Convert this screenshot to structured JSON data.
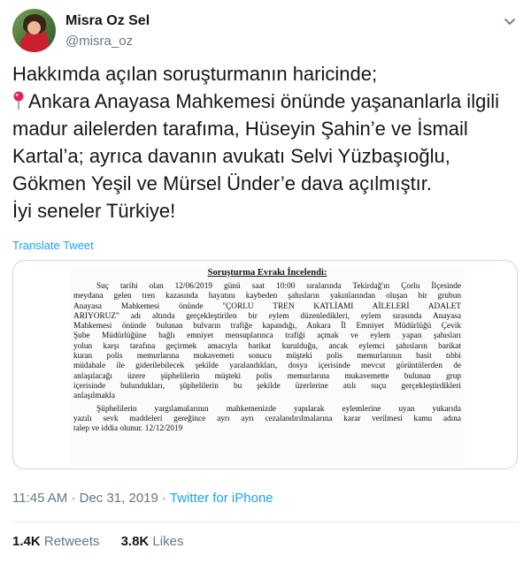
{
  "author": {
    "display_name": "Misra Oz Sel",
    "handle": "@misra_oz"
  },
  "tweet": {
    "lines": [
      "Hakkımda açılan soruşturmanın haricinde;",
      "Ankara Anayasa Mahkemesi önünde yaşananlarla ilgili",
      "madur ailelerden tarafıma, Hüseyin Şahin’e ve İsmail",
      "Kartal’a; ayrıca davanın avukatı Selvi Yüzbaşıoğlu,",
      "Gökmen Yeşil ve Mürsel Ünder’e dava açılmıştır.",
      "İyi seneler Türkiye!"
    ],
    "pin_icon": "round-pushpin-emoji",
    "translate_label": "Translate Tweet"
  },
  "document": {
    "title": "Soruşturma Evrakı İncelendi:",
    "lines": [
      "Suç tarihi olan 12/06/2019 günü saat 10:00 sıralarında Tekirdağ'ın Çorlu İlçesinde",
      "meydana gelen tren kazasında hayatını kaybeden şahısların yakınlarından oluşan bir grubun",
      "Anayasa Mahkemesi önünde \"ÇORLU TREN KATLİAMI AİLELERİ ADALET",
      "ARIYORUZ\" adı altında gerçekleştirilen bir eylem düzenledikleri, eylem sırasında Anayasa",
      "Mahkemesi önünde bulunan bulvarın trafiğe kapandığı, Ankara İl Emniyet Müdürlüğü Çevik",
      "Şube Müdürlüğüne bağlı emniyet mensuplarınca trafiği açmak ve eylem yapan şahısları",
      "yolun karşı tarafına geçirmek amacıyla barikat kurulduğu, ancak eylemci şahısların barikat",
      "kuran polis memurlarına mukavemeti sonucu müşteki polis memurlarının basit tıbbi",
      "müdahale ile giderilebilecek şekilde yaralandıkları, dosya içerisinde mevcut görüntülerden de",
      "anlaşılacağı üzere şüphelilerin müşteki polis memurlarına mukavemette bulunan grup",
      "içerisinde bulundukları, şüphelilerin bu şekilde üzerlerine atılı suçu gerçekleştirdikleri",
      "anlaşılmakla"
    ],
    "lines2": [
      "Şüphelilerin yargılamalarının mahkemenizde yapılarak eylemlerine uyan yukarıda",
      "yazılı sevk maddeleri gereğince ayrı ayrı cezalandırılmalarına karar verilmesi kamu adına",
      "talep ve iddia olunur. 12/12/2019"
    ]
  },
  "meta": {
    "time": "11:45 AM",
    "date": "Dec 31, 2019",
    "separator": "·",
    "source": "Twitter for iPhone"
  },
  "stats": {
    "retweets_count": "1.4K",
    "retweets_label": "Retweets",
    "likes_count": "3.8K",
    "likes_label": "Likes"
  },
  "colors": {
    "link": "#1da1f2",
    "secondary_text": "#657786",
    "primary_text": "#14171a",
    "border": "#ccd6dd"
  }
}
